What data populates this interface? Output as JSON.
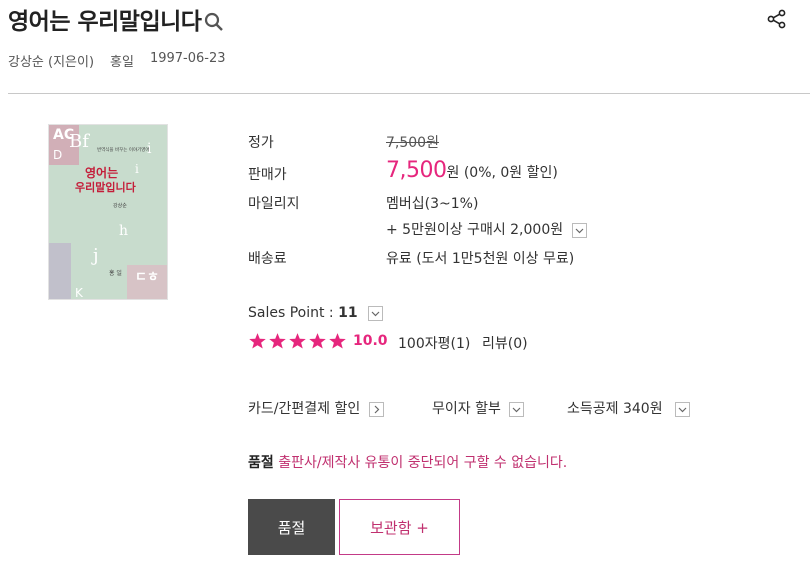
{
  "product": {
    "title": "영어는 우리말입니다",
    "author": "강상순 (지은이)",
    "publisher": "홍일",
    "date": "1997-06-23"
  },
  "cover": {
    "subtitle_text": "번역식을 바꾸는 이야기영어",
    "title_line1": "영어는",
    "title_line2": "우리말입니다",
    "author_text": "강상순",
    "publisher_text": "홍 일"
  },
  "price": {
    "list_label": "정가",
    "list_value": "7,500원",
    "sale_label": "판매가",
    "sale_value": "7,500",
    "sale_unit": "원",
    "sale_note": " (0%, 0원 할인)",
    "mileage_label": "마일리지",
    "mileage_value": "멤버십(3~1%)",
    "mileage_extra": "+ 5만원이상 구매시 2,000원",
    "shipping_label": "배송료",
    "shipping_value": "유료 (도서 1만5천원 이상 무료)"
  },
  "sales": {
    "label": "Sales Point : ",
    "value": "11",
    "rating": "10.0",
    "stars_filled": 5,
    "reviews_short": "100자평(1)",
    "reviews_long": "리뷰(0)"
  },
  "options": {
    "card": "카드/간편결제 할인",
    "installment": "무이자 할부",
    "tax": "소득공제 340원"
  },
  "status": {
    "label": "품절",
    "message": "출판사/제작사 유통이 중단되어 구할 수 없습니다."
  },
  "buttons": {
    "soldout": "품절",
    "wish": "보관함 +"
  },
  "colors": {
    "accent": "#e6267d",
    "button_dark": "#4a4a4a"
  }
}
